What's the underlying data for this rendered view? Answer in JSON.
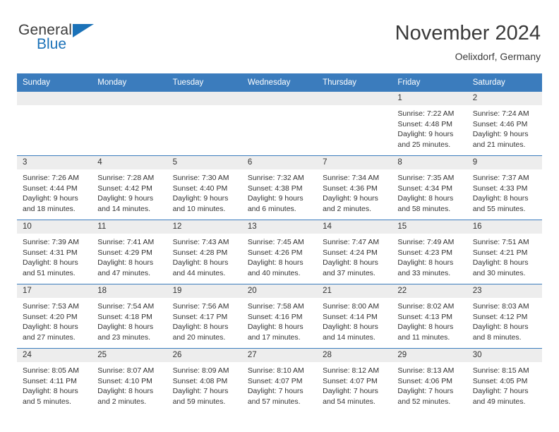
{
  "brand": {
    "name_part1": "General",
    "name_part2": "Blue",
    "triangle_icon": "triangle-icon",
    "accent_color": "#1b72b8"
  },
  "header": {
    "title": "November 2024",
    "subtitle": "Oelixdorf, Germany"
  },
  "theme": {
    "header_bar_color": "#3b7cbd",
    "daynum_strip_color": "#ededed",
    "text_color": "#333333"
  },
  "weekday_headers": [
    "Sunday",
    "Monday",
    "Tuesday",
    "Wednesday",
    "Thursday",
    "Friday",
    "Saturday"
  ],
  "weeks": [
    [
      {
        "day": "",
        "sunrise": "",
        "sunset": "",
        "daylight_line1": "",
        "daylight_line2": ""
      },
      {
        "day": "",
        "sunrise": "",
        "sunset": "",
        "daylight_line1": "",
        "daylight_line2": ""
      },
      {
        "day": "",
        "sunrise": "",
        "sunset": "",
        "daylight_line1": "",
        "daylight_line2": ""
      },
      {
        "day": "",
        "sunrise": "",
        "sunset": "",
        "daylight_line1": "",
        "daylight_line2": ""
      },
      {
        "day": "",
        "sunrise": "",
        "sunset": "",
        "daylight_line1": "",
        "daylight_line2": ""
      },
      {
        "day": "1",
        "sunrise": "Sunrise: 7:22 AM",
        "sunset": "Sunset: 4:48 PM",
        "daylight_line1": "Daylight: 9 hours",
        "daylight_line2": "and 25 minutes."
      },
      {
        "day": "2",
        "sunrise": "Sunrise: 7:24 AM",
        "sunset": "Sunset: 4:46 PM",
        "daylight_line1": "Daylight: 9 hours",
        "daylight_line2": "and 21 minutes."
      }
    ],
    [
      {
        "day": "3",
        "sunrise": "Sunrise: 7:26 AM",
        "sunset": "Sunset: 4:44 PM",
        "daylight_line1": "Daylight: 9 hours",
        "daylight_line2": "and 18 minutes."
      },
      {
        "day": "4",
        "sunrise": "Sunrise: 7:28 AM",
        "sunset": "Sunset: 4:42 PM",
        "daylight_line1": "Daylight: 9 hours",
        "daylight_line2": "and 14 minutes."
      },
      {
        "day": "5",
        "sunrise": "Sunrise: 7:30 AM",
        "sunset": "Sunset: 4:40 PM",
        "daylight_line1": "Daylight: 9 hours",
        "daylight_line2": "and 10 minutes."
      },
      {
        "day": "6",
        "sunrise": "Sunrise: 7:32 AM",
        "sunset": "Sunset: 4:38 PM",
        "daylight_line1": "Daylight: 9 hours",
        "daylight_line2": "and 6 minutes."
      },
      {
        "day": "7",
        "sunrise": "Sunrise: 7:34 AM",
        "sunset": "Sunset: 4:36 PM",
        "daylight_line1": "Daylight: 9 hours",
        "daylight_line2": "and 2 minutes."
      },
      {
        "day": "8",
        "sunrise": "Sunrise: 7:35 AM",
        "sunset": "Sunset: 4:34 PM",
        "daylight_line1": "Daylight: 8 hours",
        "daylight_line2": "and 58 minutes."
      },
      {
        "day": "9",
        "sunrise": "Sunrise: 7:37 AM",
        "sunset": "Sunset: 4:33 PM",
        "daylight_line1": "Daylight: 8 hours",
        "daylight_line2": "and 55 minutes."
      }
    ],
    [
      {
        "day": "10",
        "sunrise": "Sunrise: 7:39 AM",
        "sunset": "Sunset: 4:31 PM",
        "daylight_line1": "Daylight: 8 hours",
        "daylight_line2": "and 51 minutes."
      },
      {
        "day": "11",
        "sunrise": "Sunrise: 7:41 AM",
        "sunset": "Sunset: 4:29 PM",
        "daylight_line1": "Daylight: 8 hours",
        "daylight_line2": "and 47 minutes."
      },
      {
        "day": "12",
        "sunrise": "Sunrise: 7:43 AM",
        "sunset": "Sunset: 4:28 PM",
        "daylight_line1": "Daylight: 8 hours",
        "daylight_line2": "and 44 minutes."
      },
      {
        "day": "13",
        "sunrise": "Sunrise: 7:45 AM",
        "sunset": "Sunset: 4:26 PM",
        "daylight_line1": "Daylight: 8 hours",
        "daylight_line2": "and 40 minutes."
      },
      {
        "day": "14",
        "sunrise": "Sunrise: 7:47 AM",
        "sunset": "Sunset: 4:24 PM",
        "daylight_line1": "Daylight: 8 hours",
        "daylight_line2": "and 37 minutes."
      },
      {
        "day": "15",
        "sunrise": "Sunrise: 7:49 AM",
        "sunset": "Sunset: 4:23 PM",
        "daylight_line1": "Daylight: 8 hours",
        "daylight_line2": "and 33 minutes."
      },
      {
        "day": "16",
        "sunrise": "Sunrise: 7:51 AM",
        "sunset": "Sunset: 4:21 PM",
        "daylight_line1": "Daylight: 8 hours",
        "daylight_line2": "and 30 minutes."
      }
    ],
    [
      {
        "day": "17",
        "sunrise": "Sunrise: 7:53 AM",
        "sunset": "Sunset: 4:20 PM",
        "daylight_line1": "Daylight: 8 hours",
        "daylight_line2": "and 27 minutes."
      },
      {
        "day": "18",
        "sunrise": "Sunrise: 7:54 AM",
        "sunset": "Sunset: 4:18 PM",
        "daylight_line1": "Daylight: 8 hours",
        "daylight_line2": "and 23 minutes."
      },
      {
        "day": "19",
        "sunrise": "Sunrise: 7:56 AM",
        "sunset": "Sunset: 4:17 PM",
        "daylight_line1": "Daylight: 8 hours",
        "daylight_line2": "and 20 minutes."
      },
      {
        "day": "20",
        "sunrise": "Sunrise: 7:58 AM",
        "sunset": "Sunset: 4:16 PM",
        "daylight_line1": "Daylight: 8 hours",
        "daylight_line2": "and 17 minutes."
      },
      {
        "day": "21",
        "sunrise": "Sunrise: 8:00 AM",
        "sunset": "Sunset: 4:14 PM",
        "daylight_line1": "Daylight: 8 hours",
        "daylight_line2": "and 14 minutes."
      },
      {
        "day": "22",
        "sunrise": "Sunrise: 8:02 AM",
        "sunset": "Sunset: 4:13 PM",
        "daylight_line1": "Daylight: 8 hours",
        "daylight_line2": "and 11 minutes."
      },
      {
        "day": "23",
        "sunrise": "Sunrise: 8:03 AM",
        "sunset": "Sunset: 4:12 PM",
        "daylight_line1": "Daylight: 8 hours",
        "daylight_line2": "and 8 minutes."
      }
    ],
    [
      {
        "day": "24",
        "sunrise": "Sunrise: 8:05 AM",
        "sunset": "Sunset: 4:11 PM",
        "daylight_line1": "Daylight: 8 hours",
        "daylight_line2": "and 5 minutes."
      },
      {
        "day": "25",
        "sunrise": "Sunrise: 8:07 AM",
        "sunset": "Sunset: 4:10 PM",
        "daylight_line1": "Daylight: 8 hours",
        "daylight_line2": "and 2 minutes."
      },
      {
        "day": "26",
        "sunrise": "Sunrise: 8:09 AM",
        "sunset": "Sunset: 4:08 PM",
        "daylight_line1": "Daylight: 7 hours",
        "daylight_line2": "and 59 minutes."
      },
      {
        "day": "27",
        "sunrise": "Sunrise: 8:10 AM",
        "sunset": "Sunset: 4:07 PM",
        "daylight_line1": "Daylight: 7 hours",
        "daylight_line2": "and 57 minutes."
      },
      {
        "day": "28",
        "sunrise": "Sunrise: 8:12 AM",
        "sunset": "Sunset: 4:07 PM",
        "daylight_line1": "Daylight: 7 hours",
        "daylight_line2": "and 54 minutes."
      },
      {
        "day": "29",
        "sunrise": "Sunrise: 8:13 AM",
        "sunset": "Sunset: 4:06 PM",
        "daylight_line1": "Daylight: 7 hours",
        "daylight_line2": "and 52 minutes."
      },
      {
        "day": "30",
        "sunrise": "Sunrise: 8:15 AM",
        "sunset": "Sunset: 4:05 PM",
        "daylight_line1": "Daylight: 7 hours",
        "daylight_line2": "and 49 minutes."
      }
    ]
  ]
}
